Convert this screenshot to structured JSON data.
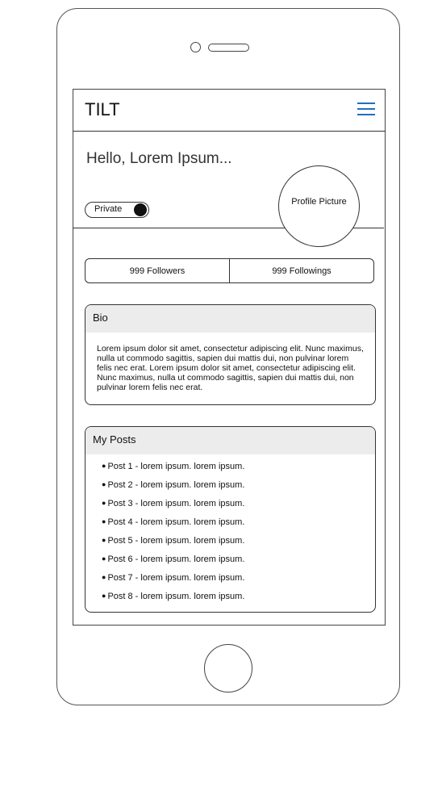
{
  "app": {
    "title": "TILT"
  },
  "header": {
    "greeting": "Hello, Lorem Ipsum...",
    "private_label": "Private",
    "profile_picture_label": "Profile Picture"
  },
  "stats": {
    "followers": "999 Followers",
    "followings": "999 Followings"
  },
  "bio": {
    "title": "Bio",
    "text": "Lorem ipsum dolor sit amet, consectetur adipiscing elit. Nunc maximus, nulla ut commodo sagittis, sapien dui mattis dui, non pulvinar lorem felis nec erat. Lorem ipsum dolor sit amet, consectetur adipiscing elit. Nunc maximus, nulla ut commodo sagittis, sapien dui mattis dui, non pulvinar lorem felis nec erat."
  },
  "posts": {
    "title": "My Posts",
    "items": [
      "Post 1 - lorem ipsum. lorem ipsum.",
      "Post 2 - lorem ipsum. lorem ipsum.",
      "Post 3 - lorem ipsum. lorem ipsum.",
      "Post 4 - lorem ipsum. lorem ipsum.",
      "Post 5 - lorem ipsum. lorem ipsum.",
      "Post 6 - lorem ipsum. lorem ipsum.",
      "Post 7 - lorem ipsum. lorem ipsum.",
      "Post 8 - lorem ipsum. lorem ipsum."
    ]
  },
  "colors": {
    "menu_icon": "#1f6fc5",
    "panel_header": "#ececec"
  },
  "icons": {
    "menu": "hamburger-menu-icon"
  }
}
